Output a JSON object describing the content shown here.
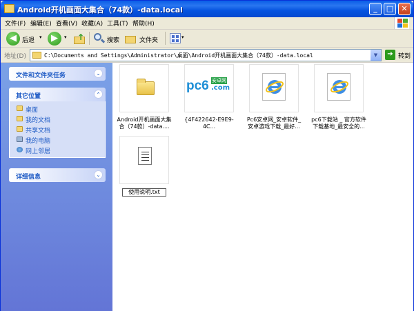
{
  "window": {
    "title": "Android开机画面大集合（74款）-data.local"
  },
  "menu": [
    "文件(F)",
    "编辑(E)",
    "查看(V)",
    "收藏(A)",
    "工具(T)",
    "帮助(H)"
  ],
  "toolbar": {
    "back": "后退",
    "search": "搜索",
    "folders": "文件夹"
  },
  "address": {
    "label": "地址(D)",
    "path": "C:\\Documents and Settings\\Administrator\\桌面\\Android开机画面大集合（74款）-data.local",
    "go": "转到"
  },
  "sidebar": {
    "tasks_title": "文件和文件夹任务",
    "places_title": "其它位置",
    "places": [
      {
        "label": "桌面",
        "icon": "desktop-icon"
      },
      {
        "label": "我的文档",
        "icon": "my-documents-icon"
      },
      {
        "label": "共享文档",
        "icon": "shared-documents-icon"
      },
      {
        "label": "我的电脑",
        "icon": "my-computer-icon"
      },
      {
        "label": "网上邻居",
        "icon": "network-icon"
      }
    ],
    "details_title": "详细信息"
  },
  "files": [
    {
      "name": "Android开机画面大集合（74款）-data....",
      "icon": "folder-icon"
    },
    {
      "name": "{4F422642-E9E9-4C...",
      "icon": "pc6-logo-icon",
      "logo_main": "pc6",
      "logo_sub": "安卓网",
      "logo_tail": ".com"
    },
    {
      "name": "Pc6安卓网_安卓软件_安卓游戏下载_最好...",
      "icon": "ie-icon"
    },
    {
      "name": "pc6下载站 _ 官方软件下载基地_最安全的...",
      "icon": "ie-icon"
    },
    {
      "name": "使用说明.txt",
      "icon": "text-file-icon"
    }
  ]
}
